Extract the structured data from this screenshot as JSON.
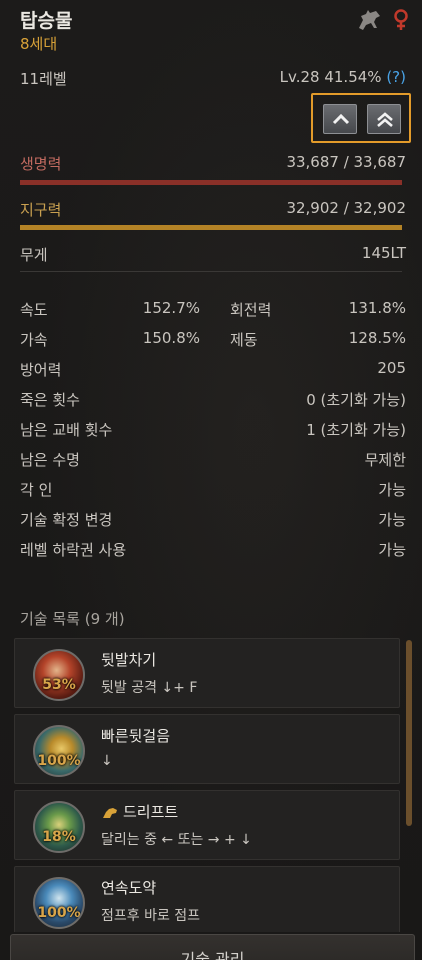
{
  "header": {
    "title": "탑승물",
    "generation": "8세대",
    "icons": [
      "horse-icon",
      "female-gender-icon"
    ],
    "gender_color": "#c0392b"
  },
  "level": {
    "label": "11레벨",
    "value": "Lv.28 41.54%",
    "help": "(?)"
  },
  "upgrade_buttons": {
    "icons": [
      "chevron-up-icon",
      "double-chevron-up-icon"
    ],
    "highlight_color": "#e39b2a"
  },
  "health": {
    "label": "생명력",
    "value": "33,687 / 33,687",
    "fill": 1.0,
    "color": "#8a3028"
  },
  "stamina": {
    "label": "지구력",
    "value": "32,902 / 32,902",
    "fill": 1.0,
    "color": "#b48326"
  },
  "weight": {
    "label": "무게",
    "value": "145LT"
  },
  "stats": {
    "speed": {
      "label": "속도",
      "value": "152.7%"
    },
    "turning": {
      "label": "회전력",
      "value": "131.8%"
    },
    "acceleration": {
      "label": "가속",
      "value": "150.8%"
    },
    "brake": {
      "label": "제동",
      "value": "128.5%"
    }
  },
  "info_rows": [
    {
      "label": "방어력",
      "value": "205"
    },
    {
      "label": "죽은 횟수",
      "value": "0 (초기화 가능)"
    },
    {
      "label": "남은 교배 횟수",
      "value": "1 (초기화 가능)"
    },
    {
      "label": "남은 수명",
      "value": "무제한"
    },
    {
      "label": "각 인",
      "value": "가능"
    },
    {
      "label": "기술 확정 변경",
      "value": "가능"
    },
    {
      "label": "레벨 하락권 사용",
      "value": "가능"
    }
  ],
  "skills": {
    "header": "기술 목록 (9 개)",
    "items": [
      {
        "name": "뒷발차기",
        "desc": "뒷발 공격 ↓+ F",
        "progress": "53%",
        "icon": "kick-skill-icon"
      },
      {
        "name": "빠른뒷걸음",
        "desc": "↓",
        "progress": "100%",
        "icon": "backstep-skill-icon"
      },
      {
        "name": "드리프트",
        "desc": "달리는 중 ← 또는 → + ↓",
        "progress": "18%",
        "icon": "drift-skill-icon"
      },
      {
        "name": "연속도약",
        "desc": "점프후 바로 점프",
        "progress": "100%",
        "icon": "jump-skill-icon"
      }
    ]
  },
  "footer": {
    "manage_button": "기술 관리"
  }
}
